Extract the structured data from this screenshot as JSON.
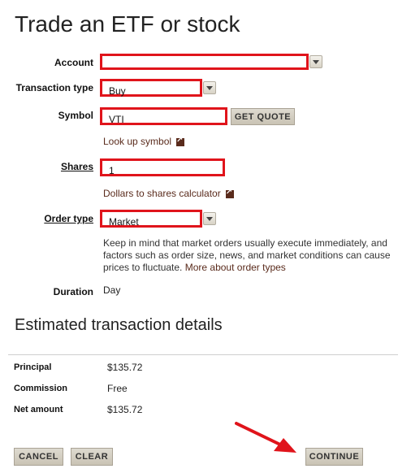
{
  "page": {
    "title": "Trade an ETF or stock"
  },
  "form": {
    "account": {
      "label": "Account",
      "value": ""
    },
    "transaction_type": {
      "label": "Transaction type",
      "value": "Buy"
    },
    "symbol": {
      "label": "Symbol",
      "value": "VTI",
      "get_quote_label": "GET QUOTE",
      "lookup_link": "Look up symbol"
    },
    "shares": {
      "label": "Shares",
      "value": "1",
      "calculator_link": "Dollars to shares calculator"
    },
    "order_type": {
      "label": "Order type",
      "value": "Market",
      "note": "Keep in mind that market orders usually execute immediately, and factors such as order size, news, and market conditions can cause prices to fluctuate.",
      "more_link": "More about order types"
    },
    "duration": {
      "label": "Duration",
      "value": "Day"
    }
  },
  "estimate": {
    "title": "Estimated transaction details",
    "rows": [
      {
        "label": "Principal",
        "value": "$135.72"
      },
      {
        "label": "Commission",
        "value": "Free"
      },
      {
        "label": "Net amount",
        "value": "$135.72"
      }
    ]
  },
  "actions": {
    "cancel": "CANCEL",
    "clear": "CLEAR",
    "continue": "CONTINUE"
  },
  "colors": {
    "highlight": "#e0141b",
    "link": "#5a2b1c",
    "button_bg": "#cfc9bb"
  },
  "icons": {
    "external_link": "external-link-icon",
    "dropdown": "chevron-down-icon",
    "annotation": "red-arrow-annotation"
  }
}
